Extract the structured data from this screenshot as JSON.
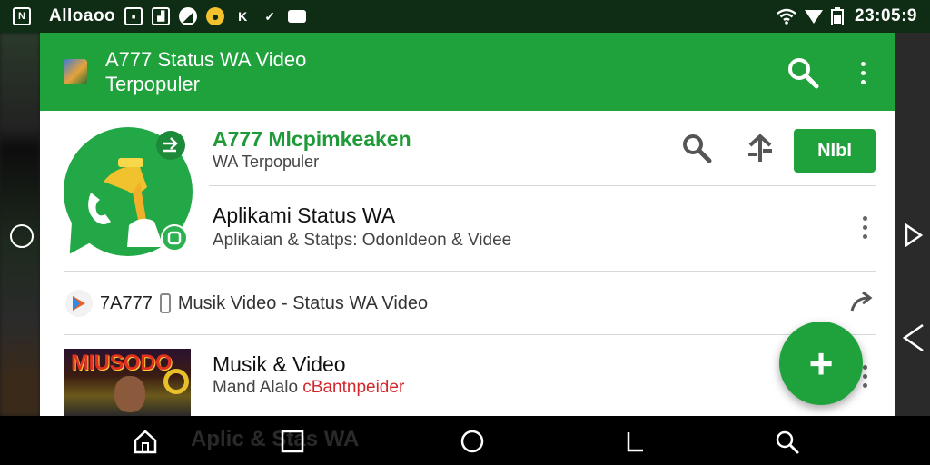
{
  "status_bar": {
    "carrier": "Alloaoo",
    "time": "23:05:9",
    "left_icons": [
      "n-box-icon",
      "square-icon",
      "chart-icon",
      "circle-icon",
      "chrome-icon",
      "k-icon",
      "check-icon",
      "message-icon"
    ],
    "right_icons": [
      "wifi-icon",
      "signal-icon",
      "battery-icon"
    ]
  },
  "toolbar": {
    "title_line1": "A777 Status WA Video",
    "title_line2": "Terpopuler",
    "bg_color": "#1fa13c"
  },
  "featured": {
    "title": "A777 Mlcpimkeaken",
    "subtitle": "WA Terpopuler",
    "install_label": "NIbI"
  },
  "app_row": {
    "title": "Aplikami Status WA",
    "subtitle": "Aplikaian & Statps: Odonldeon & Videe"
  },
  "list_row": {
    "code": "7A777",
    "label": "Musik Video - Status WA Video"
  },
  "musik_row": {
    "title": "Musik & Video",
    "subtitle_part1": "Mand Alalo ",
    "subtitle_part2": "cBantnpeider",
    "thumb_text": "MIUSODO"
  },
  "fab": {
    "label": "+"
  },
  "navbar": {
    "ghost_text": "Aplic & Stas WA",
    "buttons": [
      "home-icon",
      "square-icon",
      "circle-icon",
      "back-icon",
      "search-icon"
    ]
  },
  "accent_color": "#1fa13c"
}
